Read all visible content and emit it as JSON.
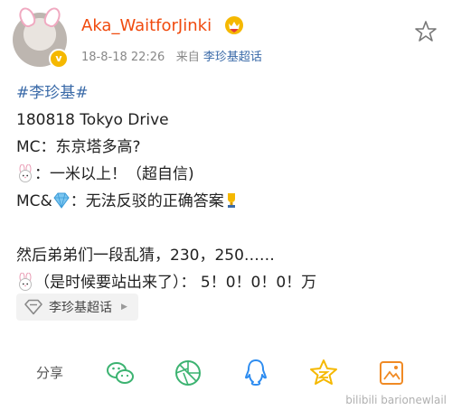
{
  "post": {
    "username": "Aka_WaitforJinki",
    "timestamp": "18-8-18 22:26",
    "from_label": "来自",
    "source": "李珍基超话"
  },
  "content": {
    "topic": "#李珍基#",
    "line1": "180818 Tokyo Drive",
    "line2": "MC：东京塔多高?",
    "line3": "：一米以上！（超自信)",
    "line4_prefix": "MC&",
    "line4_suffix": "：无法反驳的正确答案",
    "line5": "然后弟弟们一段乱猜，230，250……",
    "line6": "（是时候要站出来了）：  5！0！0！0！万"
  },
  "chip": {
    "label": "李珍基超话"
  },
  "actions": {
    "share_label": "分享"
  },
  "watermark": "bilibili barionewlail",
  "colors": {
    "username": "#f04a0e",
    "link": "#3a6aa8",
    "action_blue": "#2d8cf0",
    "action_green": "#3cb371",
    "action_yellow": "#f5b800",
    "action_orange": "#f08a24"
  },
  "icons": [
    "crown-heart-icon",
    "star-outline-icon",
    "rabbit-emoji-icon",
    "diamond-emoji-icon",
    "trophy-emoji-icon",
    "supertopic-diamond-icon",
    "wechat-icon",
    "moments-icon",
    "qq-icon",
    "qzone-icon",
    "save-image-icon"
  ]
}
